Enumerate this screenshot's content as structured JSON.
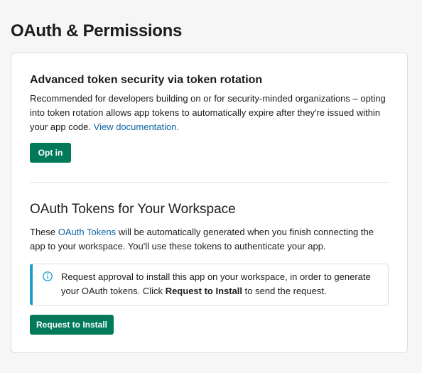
{
  "page": {
    "title": "OAuth & Permissions"
  },
  "token_rotation": {
    "heading": "Advanced token security via token rotation",
    "description": "Recommended for developers building on or for security-minded organizations – opting into token rotation allows app tokens to automatically expire after they're issued within your app code.",
    "link_label": "View documentation.",
    "button_label": "Opt in"
  },
  "oauth_tokens": {
    "heading": "OAuth Tokens for Your Workspace",
    "description_prefix": "These",
    "description_link": "OAuth Tokens",
    "description_suffix": "will be automatically generated when you finish connecting the app to your workspace. You'll use these tokens to authenticate your app.",
    "callout": {
      "icon": "info-icon",
      "text_before": "Request approval to install this app on your workspace, in order to generate your OAuth tokens. Click",
      "text_bold": "Request to Install",
      "text_after": "to send the request."
    },
    "button_label": "Request to Install"
  },
  "colors": {
    "primary_button": "#007a5a",
    "link": "#1264a3",
    "callout_accent": "#1d9bd1"
  }
}
